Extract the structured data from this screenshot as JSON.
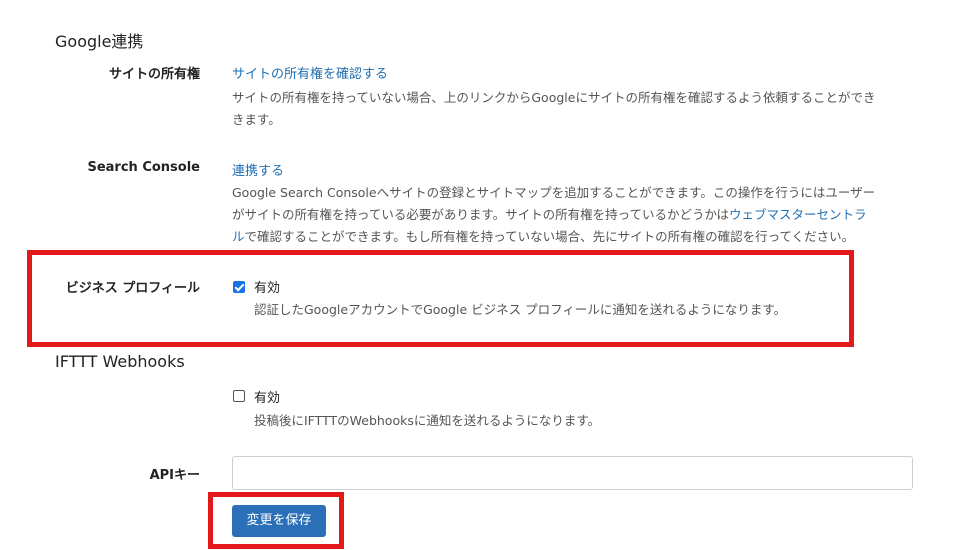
{
  "google": {
    "section_title": "Google連携",
    "ownership": {
      "label": "サイトの所有権",
      "link": "サイトの所有権を確認する",
      "desc_line1": "サイトの所有権を持っていない場合、上のリンクからGoogleにサイトの所有権を確認するよう依頼することができ",
      "desc_line2": "きます。"
    },
    "search_console": {
      "label": "Search Console",
      "link": "連携する",
      "desc_line1": "Google Search Consoleへサイトの登録とサイトマップを追加することができます。この操作を行うにはユーザー",
      "desc_line2_pre": "がサイトの所有権を持っている必要があります。サイトの所有権を持っているかどうかは",
      "desc_line2_link": "ウェブマスターセントラ",
      "desc_line3_link": "ル",
      "desc_line3_post": "で確認することができます。もし所有権を持っていない場合、先にサイトの所有権の確認を行ってください。"
    },
    "business_profile": {
      "label": "ビジネス プロフィール",
      "checkbox_label": "有効",
      "checked": true,
      "desc": "認証したGoogleアカウントでGoogle ビジネス プロフィールに通知を送れるようになります。"
    }
  },
  "ifttt": {
    "section_title": "IFTTT Webhooks",
    "checkbox_label": "有効",
    "checked": false,
    "desc": "投稿後にIFTTTのWebhooksに通知を送れるようになります。",
    "api_key_label": "APIキー",
    "api_key_value": ""
  },
  "save_button": "変更を保存",
  "colors": {
    "link": "#1f6fb4",
    "highlight": "#e3191b",
    "button": "#2a6fb7",
    "checkbox": "#1a73e8"
  }
}
